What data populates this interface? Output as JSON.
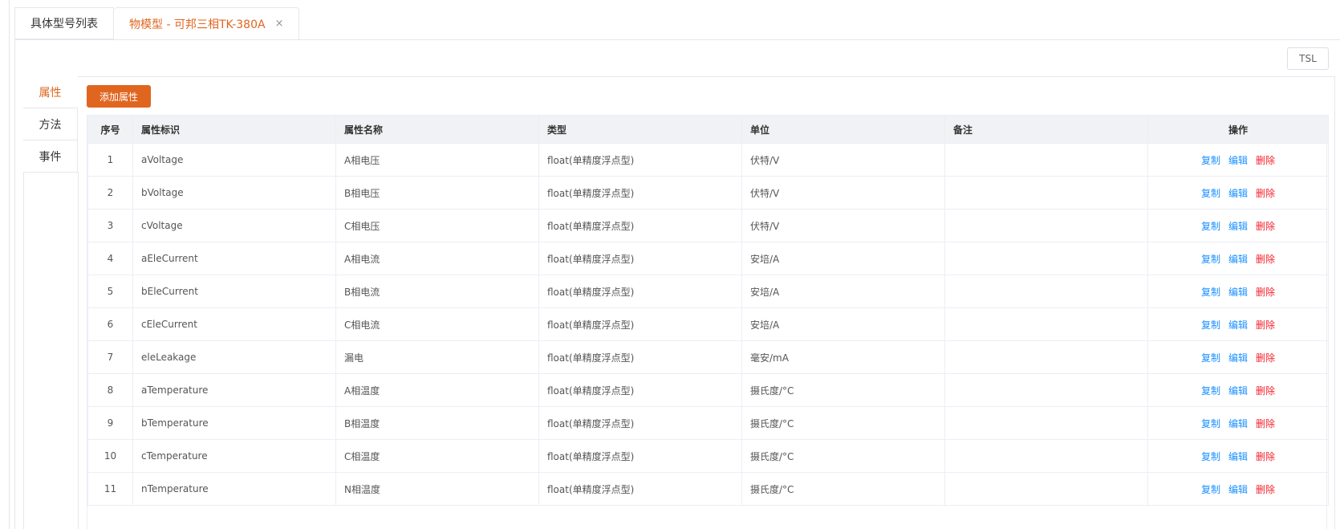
{
  "top_tabs": [
    {
      "label": "具体型号列表"
    },
    {
      "label": "物模型 - 可邦三相TK-380A",
      "close": "×"
    }
  ],
  "tsl_button": "TSL",
  "side_tabs": [
    {
      "label": "属性"
    },
    {
      "label": "方法"
    },
    {
      "label": "事件"
    }
  ],
  "add_button": "添加属性",
  "columns": [
    "序号",
    "属性标识",
    "属性名称",
    "类型",
    "单位",
    "备注",
    "操作"
  ],
  "actions": {
    "copy": "复制",
    "edit": "编辑",
    "delete": "删除"
  },
  "rows": [
    {
      "no": "1",
      "id": "aVoltage",
      "name": "A相电压",
      "type": "float(单精度浮点型)",
      "unit": "伏特/V",
      "note": ""
    },
    {
      "no": "2",
      "id": "bVoltage",
      "name": "B相电压",
      "type": "float(单精度浮点型)",
      "unit": "伏特/V",
      "note": ""
    },
    {
      "no": "3",
      "id": "cVoltage",
      "name": "C相电压",
      "type": "float(单精度浮点型)",
      "unit": "伏特/V",
      "note": ""
    },
    {
      "no": "4",
      "id": "aEleCurrent",
      "name": "A相电流",
      "type": "float(单精度浮点型)",
      "unit": "安培/A",
      "note": ""
    },
    {
      "no": "5",
      "id": "bEleCurrent",
      "name": "B相电流",
      "type": "float(单精度浮点型)",
      "unit": "安培/A",
      "note": ""
    },
    {
      "no": "6",
      "id": "cEleCurrent",
      "name": "C相电流",
      "type": "float(单精度浮点型)",
      "unit": "安培/A",
      "note": ""
    },
    {
      "no": "7",
      "id": "eleLeakage",
      "name": "漏电",
      "type": "float(单精度浮点型)",
      "unit": "毫安/mA",
      "note": ""
    },
    {
      "no": "8",
      "id": "aTemperature",
      "name": "A相温度",
      "type": "float(单精度浮点型)",
      "unit": "摄氏度/°C",
      "note": ""
    },
    {
      "no": "9",
      "id": "bTemperature",
      "name": "B相温度",
      "type": "float(单精度浮点型)",
      "unit": "摄氏度/°C",
      "note": ""
    },
    {
      "no": "10",
      "id": "cTemperature",
      "name": "C相温度",
      "type": "float(单精度浮点型)",
      "unit": "摄氏度/°C",
      "note": ""
    },
    {
      "no": "11",
      "id": "nTemperature",
      "name": "N相温度",
      "type": "float(单精度浮点型)",
      "unit": "摄氏度/°C",
      "note": ""
    }
  ],
  "colors": {
    "accent": "#e0661f",
    "link": "#1890ff",
    "danger": "#f5222d"
  }
}
